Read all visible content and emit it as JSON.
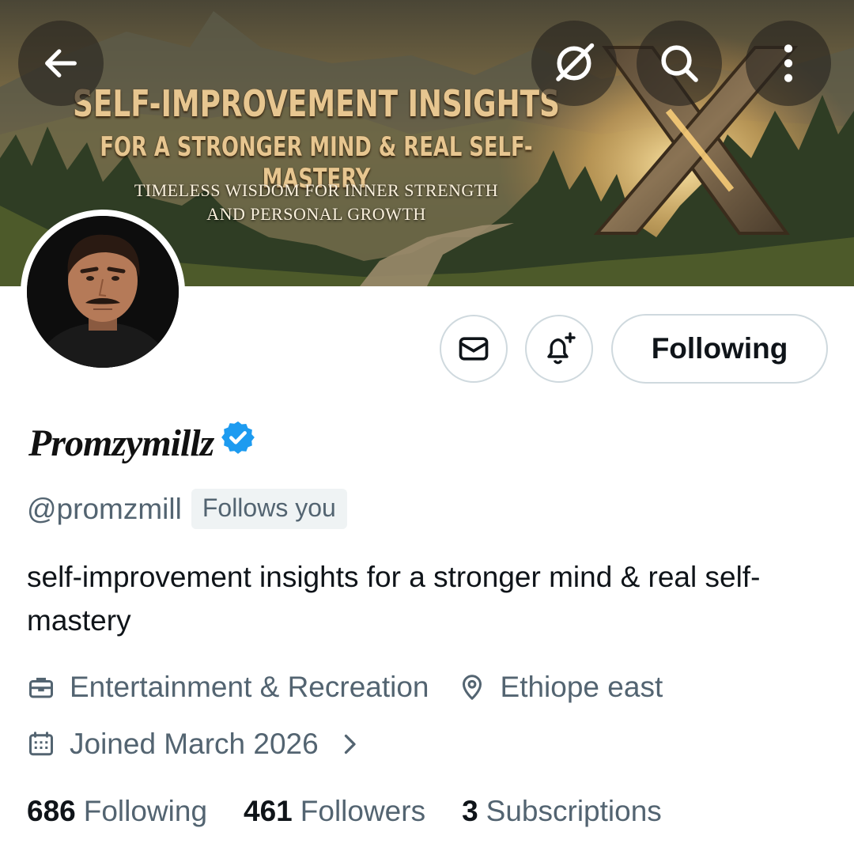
{
  "banner": {
    "title_line1": "SELF-IMPROVEMENT INSIGHTS",
    "title_line2": "FOR A STRONGER MIND & REAL SELF-MASTERY",
    "subtitle_line1": "TIMELESS WISDOM FOR INNER STRENGTH",
    "subtitle_line2": "AND PERSONAL GROWTH"
  },
  "header_actions": {
    "back_icon": "arrow-left-icon",
    "grok_icon": "grok-icon",
    "search_icon": "search-icon",
    "more_icon": "more-vertical-icon"
  },
  "profile_actions": {
    "message_icon": "envelope-icon",
    "notify_icon": "bell-plus-icon",
    "following_label": "Following"
  },
  "profile": {
    "display_name": "Promzymillz",
    "verified": true,
    "handle": "@promzmill",
    "follows_you": "Follows you",
    "bio": "self-improvement insights for a stronger mind & real self-mastery",
    "category": "Entertainment & Recreation",
    "location": "Ethiope east",
    "joined": "Joined March 2026"
  },
  "stats": {
    "following_count": "686",
    "following_label": "Following",
    "followers_count": "461",
    "followers_label": "Followers",
    "subscriptions_count": "3",
    "subscriptions_label": "Subscriptions"
  },
  "colors": {
    "text_primary": "#0f1419",
    "text_secondary": "#536471",
    "verified_blue": "#1d9bf0",
    "border": "#cfd9de",
    "badge_bg": "#eff3f4"
  }
}
